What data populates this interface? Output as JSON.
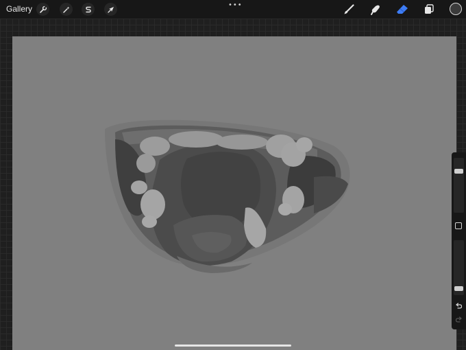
{
  "app": {
    "gallery_label": "Gallery",
    "more_dots": "•••"
  },
  "toolbar_left": [
    {
      "name": "actions",
      "icon": "wrench-icon"
    },
    {
      "name": "adjustments",
      "icon": "magic-wand-icon"
    },
    {
      "name": "selection",
      "icon": "selection-s-icon"
    },
    {
      "name": "transform",
      "icon": "arrow-cursor-icon"
    }
  ],
  "toolbar_right": [
    {
      "name": "brush",
      "icon": "brush-icon",
      "active": false
    },
    {
      "name": "smudge",
      "icon": "smudge-finger-icon",
      "active": false
    },
    {
      "name": "eraser",
      "icon": "eraser-icon",
      "active": true
    },
    {
      "name": "layers",
      "icon": "layers-icon",
      "active": false
    }
  ],
  "colors": {
    "accent": "#3d7cf5",
    "canvas": "#808080",
    "current_color": "#3b3b3b",
    "toolbar": "#171717"
  },
  "sidebar": {
    "brush_size_level": 0.1,
    "opacity_level": 0.95,
    "buttons": [
      "modify-square-icon",
      "undo-icon",
      "redo-icon"
    ]
  }
}
